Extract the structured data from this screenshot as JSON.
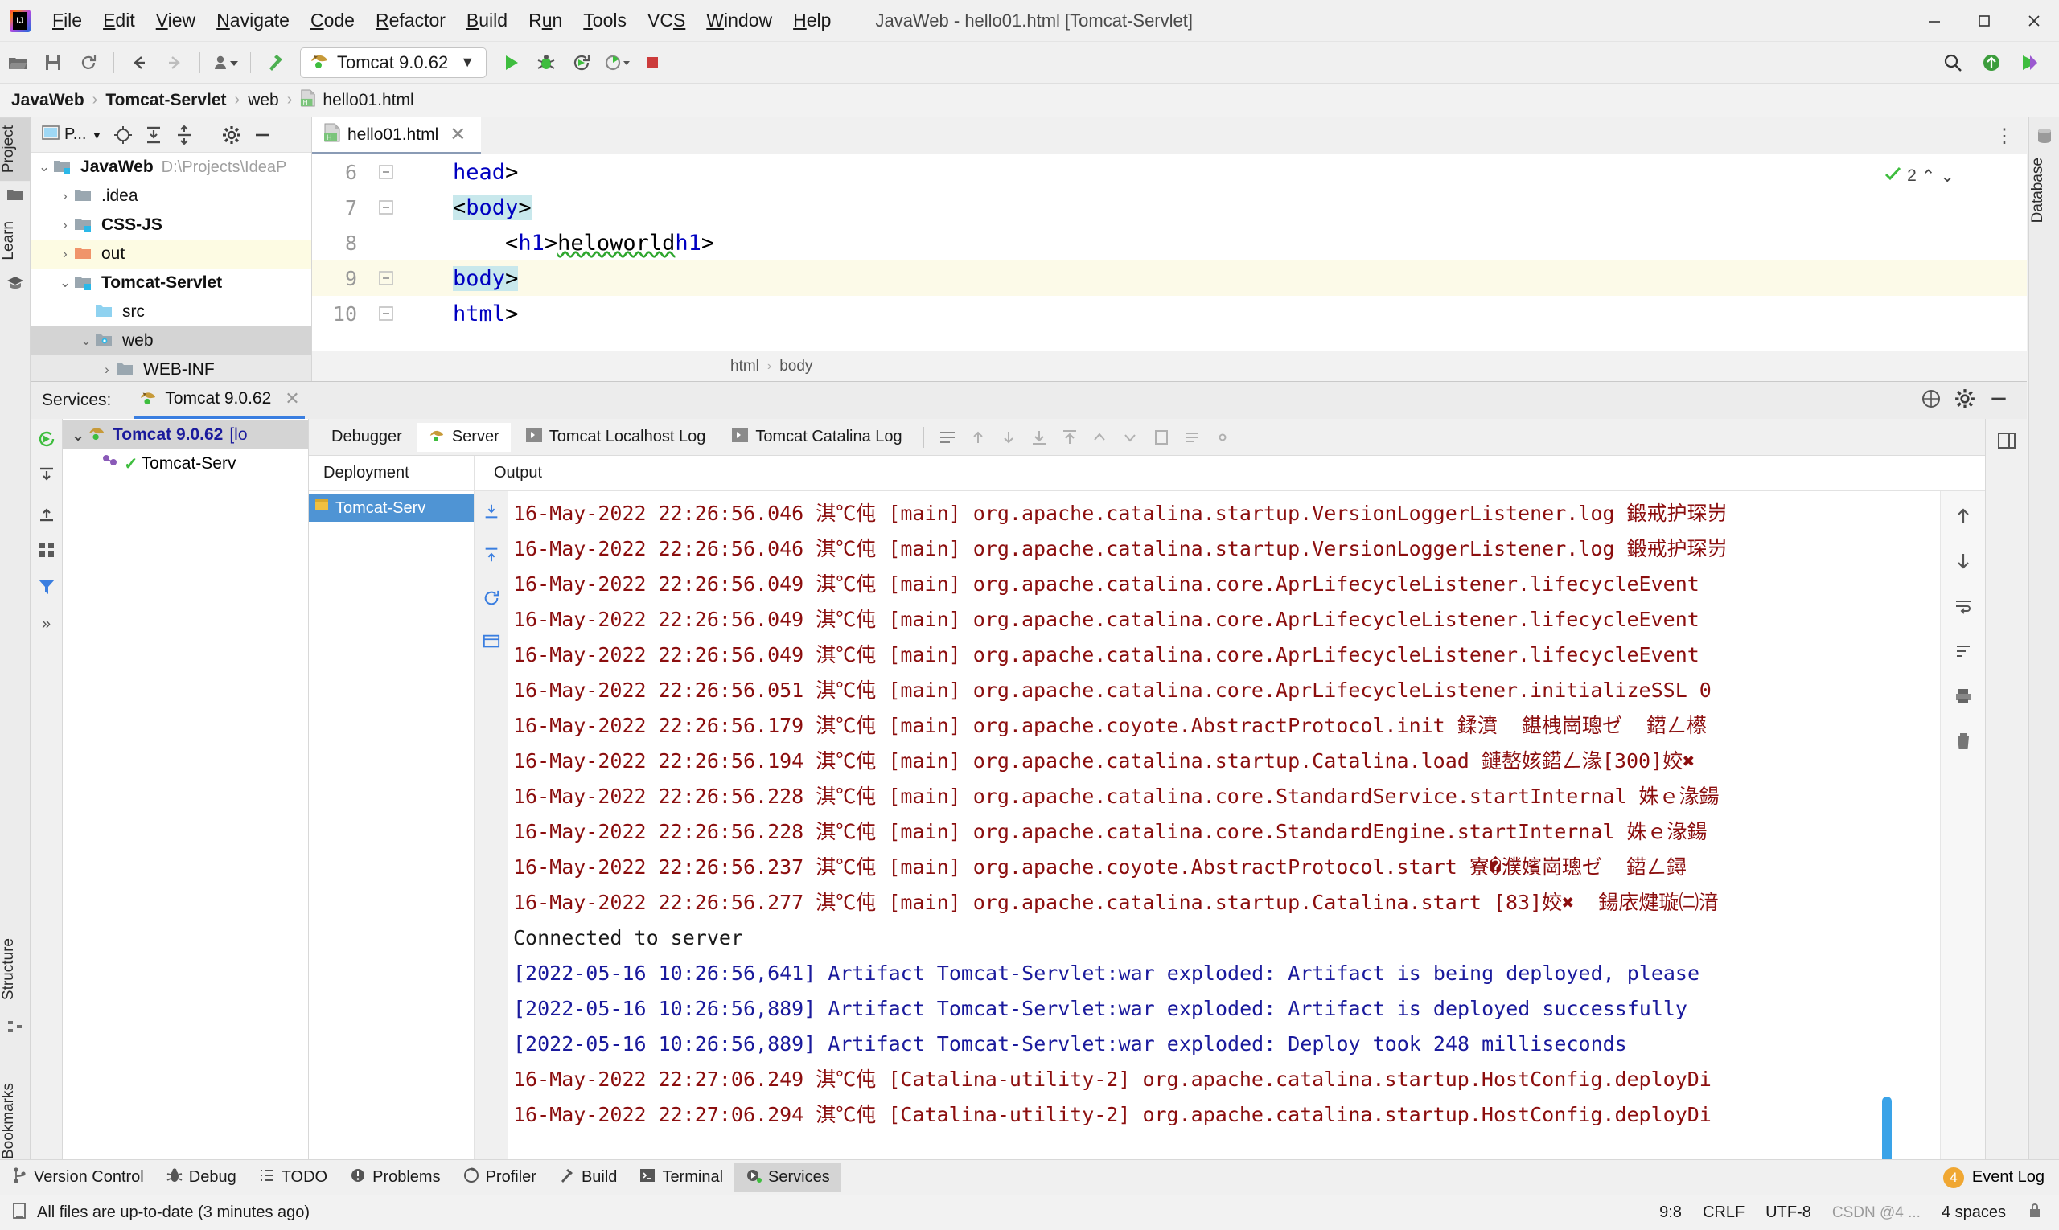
{
  "window": {
    "title": "JavaWeb - hello01.html [Tomcat-Servlet]",
    "minimize_label": "–",
    "maximize_label": "□",
    "close_label": "✕"
  },
  "menubar": {
    "items": [
      {
        "label": "File",
        "mnemonic": "F"
      },
      {
        "label": "Edit",
        "mnemonic": "E"
      },
      {
        "label": "View",
        "mnemonic": "V"
      },
      {
        "label": "Navigate",
        "mnemonic": "N"
      },
      {
        "label": "Code",
        "mnemonic": "C"
      },
      {
        "label": "Refactor",
        "mnemonic": "R"
      },
      {
        "label": "Build",
        "mnemonic": "B"
      },
      {
        "label": "Run",
        "mnemonic": "u"
      },
      {
        "label": "Tools",
        "mnemonic": "T"
      },
      {
        "label": "VCS",
        "mnemonic": "S"
      },
      {
        "label": "Window",
        "mnemonic": "W"
      },
      {
        "label": "Help",
        "mnemonic": "H"
      }
    ]
  },
  "toolbar": {
    "icons": [
      "open-folder-icon",
      "save-icon",
      "sync-icon",
      "back-arrow-icon",
      "forward-arrow-icon",
      "profile-dropdown-icon",
      "build-hammer-icon"
    ],
    "run_config": {
      "name": "Tomcat 9.0.62",
      "icon": "tomcat-cat-icon",
      "dropdown": "▼"
    },
    "run_actions": [
      "run-icon",
      "debug-icon",
      "rerun-icon",
      "coverage-icon",
      "stop-icon"
    ],
    "right_icons": [
      "search-everywhere-icon",
      "updates-icon",
      "ide-assistant-icon"
    ]
  },
  "breadcrumb": {
    "items": [
      {
        "label": "JavaWeb",
        "bold": true
      },
      {
        "label": "Tomcat-Servlet",
        "bold": true
      },
      {
        "label": "web",
        "bold": false
      },
      {
        "label": "hello01.html",
        "bold": false,
        "icon": "html-file-icon"
      }
    ],
    "separator": "›"
  },
  "left_stripe": {
    "buttons": [
      {
        "label": "Project",
        "active": true,
        "icon": "project-folder-icon"
      },
      {
        "label": "Learn",
        "active": false,
        "icon": "graduation-cap-icon"
      },
      {
        "label": "Structure",
        "active": false,
        "icon": "structure-icon"
      },
      {
        "label": "Bookmarks",
        "active": false,
        "icon": "bookmark-icon"
      }
    ]
  },
  "right_stripe": {
    "buttons": [
      {
        "label": "Database",
        "icon": "database-icon"
      }
    ]
  },
  "project_panel": {
    "selector_label": "P...",
    "toolbar_icons": [
      "locate-target-icon",
      "expand-all-icon",
      "collapse-all-icon",
      "gear-icon",
      "hide-icon"
    ],
    "tree": [
      {
        "indent": 0,
        "arrow": "⌄",
        "label": "JavaWeb",
        "bold": true,
        "path": "D:\\Projects\\IdeaP",
        "icon": "module-folder-icon",
        "state": "normal"
      },
      {
        "indent": 1,
        "arrow": "›",
        "label": ".idea",
        "bold": false,
        "path": "",
        "icon": "folder-icon",
        "state": "normal"
      },
      {
        "indent": 1,
        "arrow": "›",
        "label": "CSS-JS",
        "bold": true,
        "path": "",
        "icon": "module-folder-icon",
        "state": "normal"
      },
      {
        "indent": 1,
        "arrow": "›",
        "label": "out",
        "bold": false,
        "path": "",
        "icon": "excluded-folder-icon",
        "state": "yellow"
      },
      {
        "indent": 1,
        "arrow": "⌄",
        "label": "Tomcat-Servlet",
        "bold": true,
        "path": "",
        "icon": "module-folder-icon",
        "state": "normal"
      },
      {
        "indent": 2,
        "arrow": "",
        "label": "src",
        "bold": false,
        "path": "",
        "icon": "source-folder-icon",
        "state": "normal"
      },
      {
        "indent": 2,
        "arrow": "⌄",
        "label": "web",
        "bold": false,
        "path": "",
        "icon": "web-folder-icon",
        "state": "grey"
      },
      {
        "indent": 3,
        "arrow": "›",
        "label": "WEB-INF",
        "bold": false,
        "path": "",
        "icon": "folder-icon",
        "state": "light"
      }
    ]
  },
  "editor": {
    "tab": {
      "label": "hello01.html",
      "icon": "html-file-icon",
      "close": "✕"
    },
    "options_icon": "editor-options-icon",
    "inspection": {
      "count": "2",
      "icon": "inspection-ok-icon",
      "up": "⌃",
      "down": "⌄"
    },
    "lines": [
      {
        "num": "6",
        "indent": 4,
        "text": "</head>",
        "fold": true,
        "highlight": false,
        "selected": false
      },
      {
        "num": "7",
        "indent": 4,
        "text": "<body>",
        "fold": true,
        "highlight": false,
        "selected": true
      },
      {
        "num": "8",
        "indent": 8,
        "text": "<h1>heloworld</h1>",
        "fold": false,
        "highlight": false,
        "selected": false,
        "typo": "heloworld"
      },
      {
        "num": "9",
        "indent": 4,
        "text": "</body>",
        "fold": true,
        "highlight": true,
        "selected": true
      },
      {
        "num": "10",
        "indent": 4,
        "text": "</html>",
        "fold": true,
        "highlight": false,
        "selected": false
      }
    ],
    "breadcrumb": [
      "html",
      "body"
    ],
    "breadcrumb_separator": "›"
  },
  "services": {
    "title": "Services:",
    "tab": {
      "label": "Tomcat 9.0.62",
      "icon": "tomcat-cat-icon",
      "close": "✕"
    },
    "header_icons": [
      "help-icon",
      "settings-gear-icon",
      "hide-icon"
    ],
    "left_rail_icons": [
      "rerun-icon",
      "expand-all-icon",
      "collapse-all-icon",
      "group-icon",
      "filter-icon",
      "more-icon"
    ],
    "tree_root": {
      "label": "Tomcat 9.0.62",
      "suffix": "[lo",
      "icon": "tomcat-cat-icon",
      "arrow": "⌄"
    },
    "tree_child": {
      "label": "Tomcat-Serv",
      "icon": "deployment-icon",
      "check": "✓"
    },
    "tabs": [
      {
        "label": "Debugger",
        "icon": "",
        "active": false
      },
      {
        "label": "Server",
        "icon": "tomcat-cat-icon",
        "active": true
      },
      {
        "label": "Tomcat Localhost Log",
        "icon": "console-icon",
        "active": false
      },
      {
        "label": "Tomcat Catalina Log",
        "icon": "console-icon",
        "active": false
      }
    ],
    "tab_actions": [
      "soft-wrap-icon",
      "scroll-up-icon",
      "scroll-down-icon",
      "export-icon",
      "import-icon",
      "up-icon",
      "down-icon",
      "print-icon",
      "clear-icon",
      "settings-icon"
    ],
    "columns": {
      "deployment": "Deployment",
      "output": "Output"
    },
    "deployment_item": {
      "label": "Tomcat-Serv",
      "icon": "artifact-icon"
    },
    "deploy_rail_icons": [
      "redeploy-icon",
      "undeploy-icon",
      "restart-icon",
      "open-browser-icon"
    ],
    "console_rail_icons": [
      "up-arrow-icon",
      "down-arrow-icon",
      "wrap-icon",
      "sort-icon",
      "print-icon",
      "trash-icon"
    ],
    "side_rail_icons": [
      "layout-icon",
      "settings-icon"
    ],
    "console_lines": [
      {
        "type": "tomcat",
        "date": "16-May-2022 22:26:56.046",
        "level": "淇℃伅",
        "thread": "[main]",
        "msg": "org.apache.catalina.startup.VersionLoggerListener.log 鍛戒护琛岃"
      },
      {
        "type": "tomcat",
        "date": "16-May-2022 22:26:56.046",
        "level": "淇℃伅",
        "thread": "[main]",
        "msg": "org.apache.catalina.startup.VersionLoggerListener.log 鍛戒护琛岃"
      },
      {
        "type": "tomcat",
        "date": "16-May-2022 22:26:56.049",
        "level": "淇℃伅",
        "thread": "[main]",
        "msg": "org.apache.catalina.core.AprLifecycleListener.lifecycleEvent"
      },
      {
        "type": "tomcat",
        "date": "16-May-2022 22:26:56.049",
        "level": "淇℃伅",
        "thread": "[main]",
        "msg": "org.apache.catalina.core.AprLifecycleListener.lifecycleEvent"
      },
      {
        "type": "tomcat",
        "date": "16-May-2022 22:26:56.049",
        "level": "淇℃伅",
        "thread": "[main]",
        "msg": "org.apache.catalina.core.AprLifecycleListener.lifecycleEvent"
      },
      {
        "type": "tomcat",
        "date": "16-May-2022 22:26:56.051",
        "level": "淇℃伅",
        "thread": "[main]",
        "msg": "org.apache.catalina.core.AprLifecycleListener.initializeSSL 0"
      },
      {
        "type": "tomcat",
        "date": "16-May-2022 22:26:56.179",
        "level": "淇℃伅",
        "thread": "[main]",
        "msg": "org.apache.coyote.AbstractProtocol.init 鍒濆  鍖栧崗璁ゼ  鍣ㄥ櫒"
      },
      {
        "type": "tomcat",
        "date": "16-May-2022 22:26:56.194",
        "level": "淇℃伅",
        "thread": "[main]",
        "msg": "org.apache.catalina.startup.Catalina.load 鏈嶅姟鍣ㄥ湪[300]姣✖"
      },
      {
        "type": "tomcat",
        "date": "16-May-2022 22:26:56.228",
        "level": "淇℃伅",
        "thread": "[main]",
        "msg": "org.apache.catalina.core.StandardService.startInternal 姝ｅ湪鍚"
      },
      {
        "type": "tomcat",
        "date": "16-May-2022 22:26:56.228",
        "level": "淇℃伅",
        "thread": "[main]",
        "msg": "org.apache.catalina.core.StandardEngine.startInternal 姝ｅ湪鍚"
      },
      {
        "type": "tomcat",
        "date": "16-May-2022 22:26:56.237",
        "level": "淇℃伅",
        "thread": "[main]",
        "msg": "org.apache.coyote.AbstractProtocol.start 寮�濮嬪崗璁ゼ  鍣ㄥ鐞"
      },
      {
        "type": "tomcat",
        "date": "16-May-2022 22:26:56.277",
        "level": "淇℃伅",
        "thread": "[main]",
        "msg": "org.apache.catalina.startup.Catalina.start [83]姣✖  鍚庡煡璇㈡湇"
      },
      {
        "type": "plain",
        "text": "Connected to server"
      },
      {
        "type": "artifact",
        "text": "[2022-05-16 10:26:56,641] Artifact Tomcat-Servlet:war exploded: Artifact is being deployed, please"
      },
      {
        "type": "artifact",
        "text": "[2022-05-16 10:26:56,889] Artifact Tomcat-Servlet:war exploded: Artifact is deployed successfully"
      },
      {
        "type": "artifact",
        "text": "[2022-05-16 10:26:56,889] Artifact Tomcat-Servlet:war exploded: Deploy took 248 milliseconds"
      },
      {
        "type": "tomcat",
        "date": "16-May-2022 22:27:06.249",
        "level": "淇℃伅",
        "thread": "[Catalina-utility-2]",
        "msg": "org.apache.catalina.startup.HostConfig.deployDi"
      },
      {
        "type": "tomcat",
        "date": "16-May-2022 22:27:06.294",
        "level": "淇℃伅",
        "thread": "[Catalina-utility-2]",
        "msg": "org.apache.catalina.startup.HostConfig.deployDi"
      }
    ]
  },
  "bottom_bar": {
    "items": [
      {
        "label": "Version Control",
        "icon": "branch-icon",
        "active": false
      },
      {
        "label": "Debug",
        "icon": "bug-icon",
        "active": false
      },
      {
        "label": "TODO",
        "icon": "list-icon",
        "active": false
      },
      {
        "label": "Problems",
        "icon": "error-circle-icon",
        "active": false
      },
      {
        "label": "Profiler",
        "icon": "profiler-icon",
        "active": false
      },
      {
        "label": "Build",
        "icon": "hammer-icon",
        "active": false
      },
      {
        "label": "Terminal",
        "icon": "terminal-icon",
        "active": false
      },
      {
        "label": "Services",
        "icon": "services-icon",
        "active": true
      }
    ],
    "event_log": {
      "label": "Event Log",
      "count": "4",
      "icon": "event-log-icon"
    }
  },
  "status_bar": {
    "message": "All files are up-to-date (3 minutes ago)",
    "message_icon": "document-icon",
    "caret": "9:8",
    "line_sep": "CRLF",
    "encoding": "UTF-8",
    "indent": "4 spaces",
    "watermark": "CSDN @4 ...",
    "lock_icon": "lock-icon"
  },
  "colors": {
    "accent_blue": "#3a7ee0",
    "tomcat_green": "#3ebd3e",
    "log_red": "#8b0e0e",
    "log_blue": "#1a1a9c",
    "selection_cyan": "#c8e8ec",
    "deploy_blue": "#4f94d4",
    "warn_orange": "#f0a732"
  }
}
